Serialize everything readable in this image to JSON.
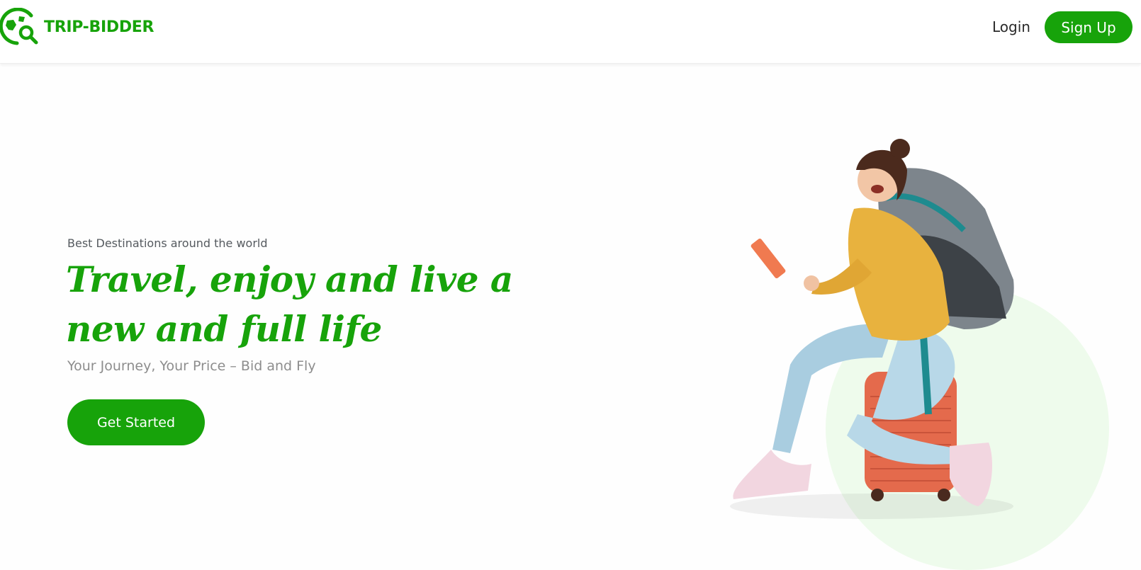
{
  "brand": {
    "name": "TRIP-BIDDER",
    "color": "#17a30a",
    "logo_icon": "globe-search-icon"
  },
  "nav": {
    "login_label": "Login",
    "signup_label": "Sign Up"
  },
  "hero": {
    "eyebrow": "Best Destinations around the world",
    "headline_line1": "Travel, enjoy and live a",
    "headline_line2": "new and full life",
    "tagline": "Your Journey, Your Price – Bid and Fly",
    "cta_label": "Get Started",
    "image": "traveler-on-suitcase-illustration"
  }
}
